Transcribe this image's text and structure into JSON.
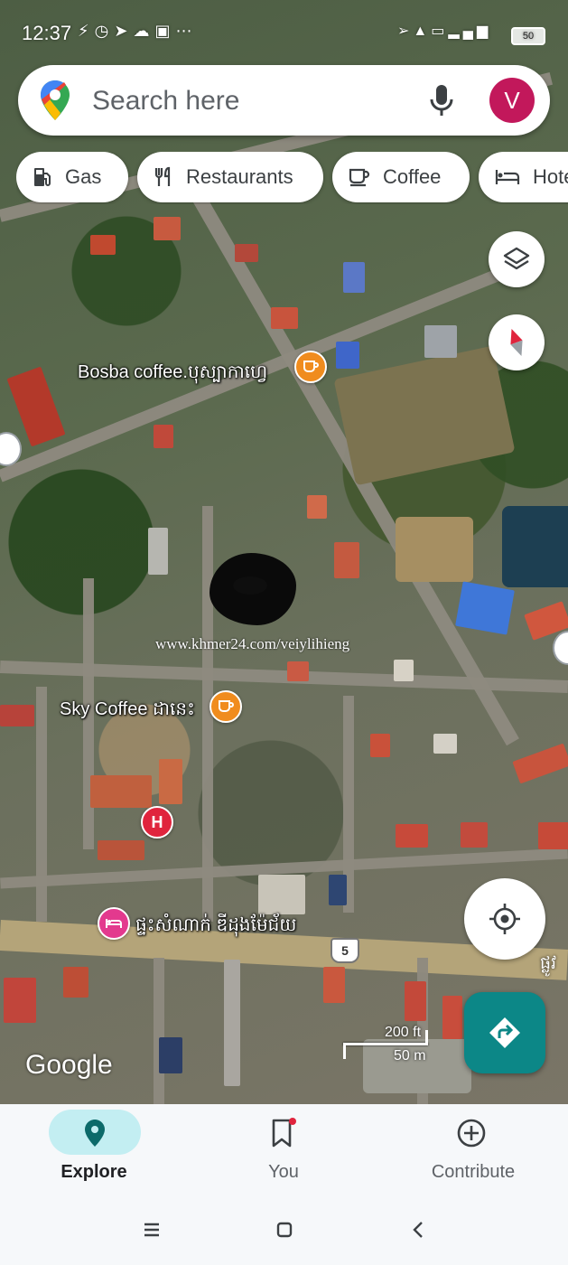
{
  "status_bar": {
    "time": "12:37",
    "left_icons": [
      "signal-broken-icon",
      "clock-icon",
      "navigation-icon",
      "cloud-icon",
      "photo-icon",
      "more-icon"
    ],
    "right_icons": [
      "location-icon",
      "4g-signal-icon",
      "volte-icon",
      "signal-bars-icon"
    ],
    "battery": "50"
  },
  "search": {
    "placeholder": "Search here",
    "value": "",
    "avatar_letter": "V",
    "avatar_color": "#c2185b"
  },
  "chips": [
    {
      "label": "Gas",
      "icon": "gas-station-icon"
    },
    {
      "label": "Restaurants",
      "icon": "fork-knife-icon"
    },
    {
      "label": "Coffee",
      "icon": "coffee-cup-icon"
    },
    {
      "label": "Hotels",
      "icon": "bed-icon"
    }
  ],
  "map": {
    "pois": [
      {
        "label": "Bosba coffee.បុស្បាកាហ្វេ",
        "type": "coffee",
        "icon": "coffee-cup-icon",
        "color": "#f08c1e"
      },
      {
        "label": "Sky Coffee ដានេះ",
        "type": "coffee",
        "icon": "coffee-cup-icon",
        "color": "#f08c1e"
      },
      {
        "label": "ផ្ទះសំណាក់ ឌីដុងម៉ែជ័យ",
        "type": "lodging",
        "icon": "bed-icon",
        "color": "#e3398e"
      },
      {
        "label": "H",
        "type": "hospital",
        "icon": "hospital-icon",
        "color": "#e0243d"
      }
    ],
    "watermark": "www.khmer24.com/veiylihieng",
    "route_number": "5",
    "edge_label": "ផ្លូវ",
    "attribution": "Google",
    "scale": {
      "imperial": "200 ft",
      "metric": "50 m"
    }
  },
  "controls": {
    "layers": "layers-icon",
    "compass": "compass-icon",
    "my_location": "my-location-icon",
    "directions": "directions-icon",
    "accent": "#0c8787"
  },
  "bottom_nav": {
    "items": [
      {
        "label": "Explore",
        "icon": "location-pin-icon",
        "active": true
      },
      {
        "label": "You",
        "icon": "bookmark-icon",
        "active": false,
        "badge": true
      },
      {
        "label": "Contribute",
        "icon": "add-circle-icon",
        "active": false
      }
    ]
  },
  "system_nav": [
    "menu-icon",
    "home-icon",
    "back-icon"
  ]
}
